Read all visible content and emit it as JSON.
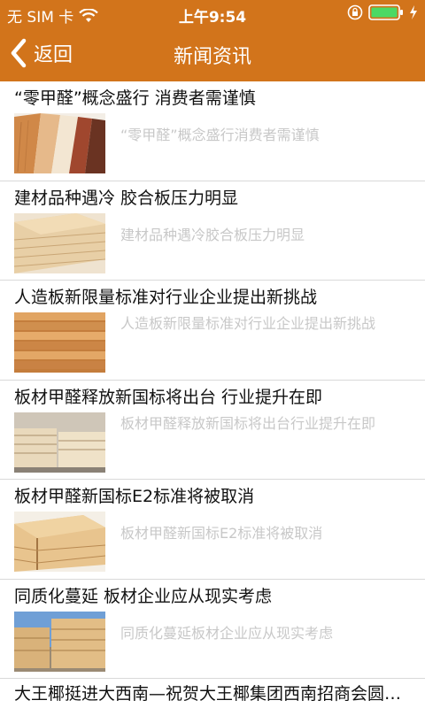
{
  "status_bar": {
    "carrier": "无 SIM 卡",
    "time": "上午9:54",
    "icons": [
      "wifi-icon",
      "rotation-lock-icon",
      "battery-icon",
      "charging-icon"
    ]
  },
  "nav": {
    "back_label": "返回",
    "title": "新闻资讯"
  },
  "theme": {
    "accent": "#d2741b",
    "summary_color": "#c8c8c8",
    "divider": "#d9d9d9"
  },
  "news": [
    {
      "title": "“零甲醛”概念盛行 消费者需谨慎",
      "summary": "“零甲醛”概念盛行消费者需谨慎"
    },
    {
      "title": "建材品种遇冷 胶合板压力明显",
      "summary": "建材品种遇冷胶合板压力明显"
    },
    {
      "title": "人造板新限量标准对行业企业提出新挑战",
      "summary": "人造板新限量标准对行业企业提出新挑战"
    },
    {
      "title": "板材甲醛释放新国标将出台 行业提升在即",
      "summary": "板材甲醛释放新国标将出台行业提升在即"
    },
    {
      "title": "板材甲醛新国标E2标准将被取消",
      "summary": "板材甲醛新国标E2标准将被取消"
    },
    {
      "title": "同质化蔓延 板材企业应从现实考虑",
      "summary": "同质化蔓延板材企业应从现实考虑"
    },
    {
      "title": "大王椰挺进大西南—祝贺大王椰集团西南招商会圆满成功"
    }
  ]
}
